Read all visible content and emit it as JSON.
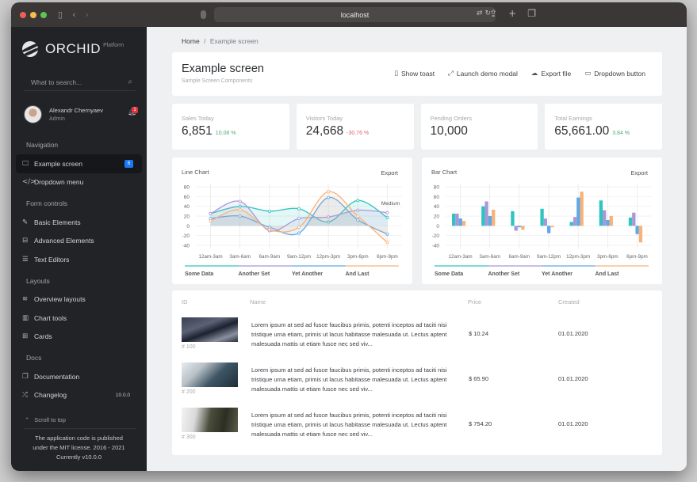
{
  "browser": {
    "url": "localhost",
    "traffic_lights": {
      "close": "#ed5f57",
      "minimize": "#f4bd4f",
      "maximize": "#5fc454"
    }
  },
  "sidebar": {
    "logo_text": "ORCHID",
    "logo_sup": "Platform",
    "search_placeholder": "What to search...",
    "user": {
      "name": "Alexandr Chernyaev",
      "role": "Admin",
      "notifications": "1"
    },
    "sections": [
      {
        "title": "Navigation",
        "items": [
          {
            "icon": "monitor-icon",
            "glyph": "🖵",
            "label": "Example screen",
            "badge": "6",
            "active": true
          },
          {
            "icon": "code-icon",
            "glyph": "</>",
            "label": "Dropdown menu"
          }
        ]
      },
      {
        "title": "Form controls",
        "items": [
          {
            "icon": "edit-icon",
            "glyph": "✎",
            "label": "Basic Elements"
          },
          {
            "icon": "briefcase-icon",
            "glyph": "⊟",
            "label": "Advanced Elements"
          },
          {
            "icon": "list-icon",
            "glyph": "☰",
            "label": "Text Editors"
          }
        ]
      },
      {
        "title": "Layouts",
        "items": [
          {
            "icon": "layers-icon",
            "glyph": "≋",
            "label": "Overview layouts"
          },
          {
            "icon": "bar-chart-icon",
            "glyph": "▥",
            "label": "Chart tools"
          },
          {
            "icon": "grid-icon",
            "glyph": "⊞",
            "label": "Cards"
          }
        ]
      },
      {
        "title": "Docs",
        "items": [
          {
            "icon": "docs-icon",
            "glyph": "❐",
            "label": "Documentation"
          },
          {
            "icon": "shuffle-icon",
            "glyph": "⤮",
            "label": "Changelog",
            "version": "10.0.0"
          }
        ]
      }
    ],
    "scroll_top": "Scroll to top",
    "footer": [
      "The application code is published",
      "under the MIT license. 2016 - 2021",
      "Currently v10.0.0"
    ]
  },
  "breadcrumb": {
    "home": "Home",
    "separator": "/",
    "current": "Example screen"
  },
  "header": {
    "title": "Example screen",
    "subtitle": "Sample Screen Components",
    "actions": [
      {
        "icon": "clipboard-icon",
        "glyph": "▯",
        "label": "Show toast"
      },
      {
        "icon": "expand-icon",
        "glyph": "⤢",
        "label": "Launch demo modal"
      },
      {
        "icon": "cloud-download-icon",
        "glyph": "☁",
        "label": "Export file"
      },
      {
        "icon": "folder-icon",
        "glyph": "▭",
        "label": "Dropdown button"
      }
    ]
  },
  "stats": [
    {
      "label": "Sales Today",
      "value": "6,851",
      "delta": "10.08 %",
      "trend": "up"
    },
    {
      "label": "Visitors Today",
      "value": "24,668",
      "delta": "-30.76 %",
      "trend": "down"
    },
    {
      "label": "Pending Orders",
      "value": "10,000",
      "delta": "",
      "trend": ""
    },
    {
      "label": "Total Earnings",
      "value": "65,661.00",
      "delta": "3.84 %",
      "trend": "up"
    }
  ],
  "colors": {
    "up": "#4caf72",
    "down": "#e0687a",
    "teal": "#2ec4c0",
    "purple": "#a898d8",
    "blue": "#5ea8e8",
    "orange": "#f7b27a"
  },
  "chart_data": [
    {
      "type": "line",
      "title": "Line Chart",
      "export_label": "Export",
      "annotation": "Medium",
      "categories": [
        "12am-3am",
        "3am-6am",
        "6am-9am",
        "9am-12pm",
        "12pm-3pm",
        "3pm-6pm",
        "6pm-9pm"
      ],
      "ylim": [
        -40,
        80
      ],
      "yticks": [
        80,
        60,
        40,
        20,
        0,
        -20,
        -40
      ],
      "grid": true,
      "legend_position": "bottom",
      "series": [
        {
          "name": "Some Data",
          "color": "#2ec4c0",
          "values": [
            25,
            40,
            30,
            35,
            8,
            52,
            17
          ]
        },
        {
          "name": "Another Set",
          "color": "#a898d8",
          "values": [
            25,
            50,
            -10,
            15,
            18,
            32,
            27
          ]
        },
        {
          "name": "Yet Another",
          "color": "#5ea8e8",
          "values": [
            15,
            20,
            -3,
            -15,
            58,
            12,
            -17
          ]
        },
        {
          "name": "And Last",
          "color": "#f7b27a",
          "values": [
            10,
            33,
            -8,
            -3,
            70,
            20,
            -34
          ]
        }
      ]
    },
    {
      "type": "bar",
      "title": "Bar Chart",
      "export_label": "Export",
      "categories": [
        "12am-3am",
        "3am-6am",
        "6am-9am",
        "9am-12pm",
        "12pm-3pm",
        "3pm-6pm",
        "6pm-9pm"
      ],
      "ylim": [
        -40,
        80
      ],
      "yticks": [
        80,
        60,
        40,
        20,
        0,
        -20,
        -40
      ],
      "grid": true,
      "legend_position": "bottom",
      "series": [
        {
          "name": "Some Data",
          "color": "#2ec4c0",
          "values": [
            25,
            40,
            30,
            35,
            8,
            52,
            17
          ]
        },
        {
          "name": "Another Set",
          "color": "#a898d8",
          "values": [
            25,
            50,
            -10,
            15,
            18,
            32,
            27
          ]
        },
        {
          "name": "Yet Another",
          "color": "#5ea8e8",
          "values": [
            15,
            20,
            -3,
            -15,
            58,
            12,
            -17
          ]
        },
        {
          "name": "And Last",
          "color": "#f7b27a",
          "values": [
            10,
            33,
            -8,
            -3,
            70,
            20,
            -34
          ]
        }
      ]
    }
  ],
  "table": {
    "columns": [
      "ID",
      "Name",
      "Price",
      "Created"
    ],
    "rows": [
      {
        "id": "# 100",
        "name": "Lorem ipsum at sed ad fusce faucibus primis, potenti inceptos ad taciti nisi tristique urna etiam, primis ut lacus habitasse malesuada ut. Lectus aptent malesuada mattis ut etiam fusce nec sed viv...",
        "price": "$ 10.24",
        "created": "01.01.2020",
        "thumb": "blurred-dark-photo"
      },
      {
        "id": "# 200",
        "name": "Lorem ipsum at sed ad fusce faucibus primis, potenti inceptos ad taciti nisi tristique urna etiam, primis ut lacus habitasse malesuada ut. Lectus aptent malesuada mattis ut etiam fusce nec sed viv...",
        "price": "$ 65.90",
        "created": "01.01.2020",
        "thumb": "misty-forest-photo"
      },
      {
        "id": "# 300",
        "name": "Lorem ipsum at sed ad fusce faucibus primis, potenti inceptos ad taciti nisi tristique urna etiam, primis ut lacus habitasse malesuada ut. Lectus aptent malesuada mattis ut etiam fusce nec sed viv...",
        "price": "$ 754.20",
        "created": "01.01.2020",
        "thumb": "foggy-cliff-photo"
      }
    ]
  }
}
